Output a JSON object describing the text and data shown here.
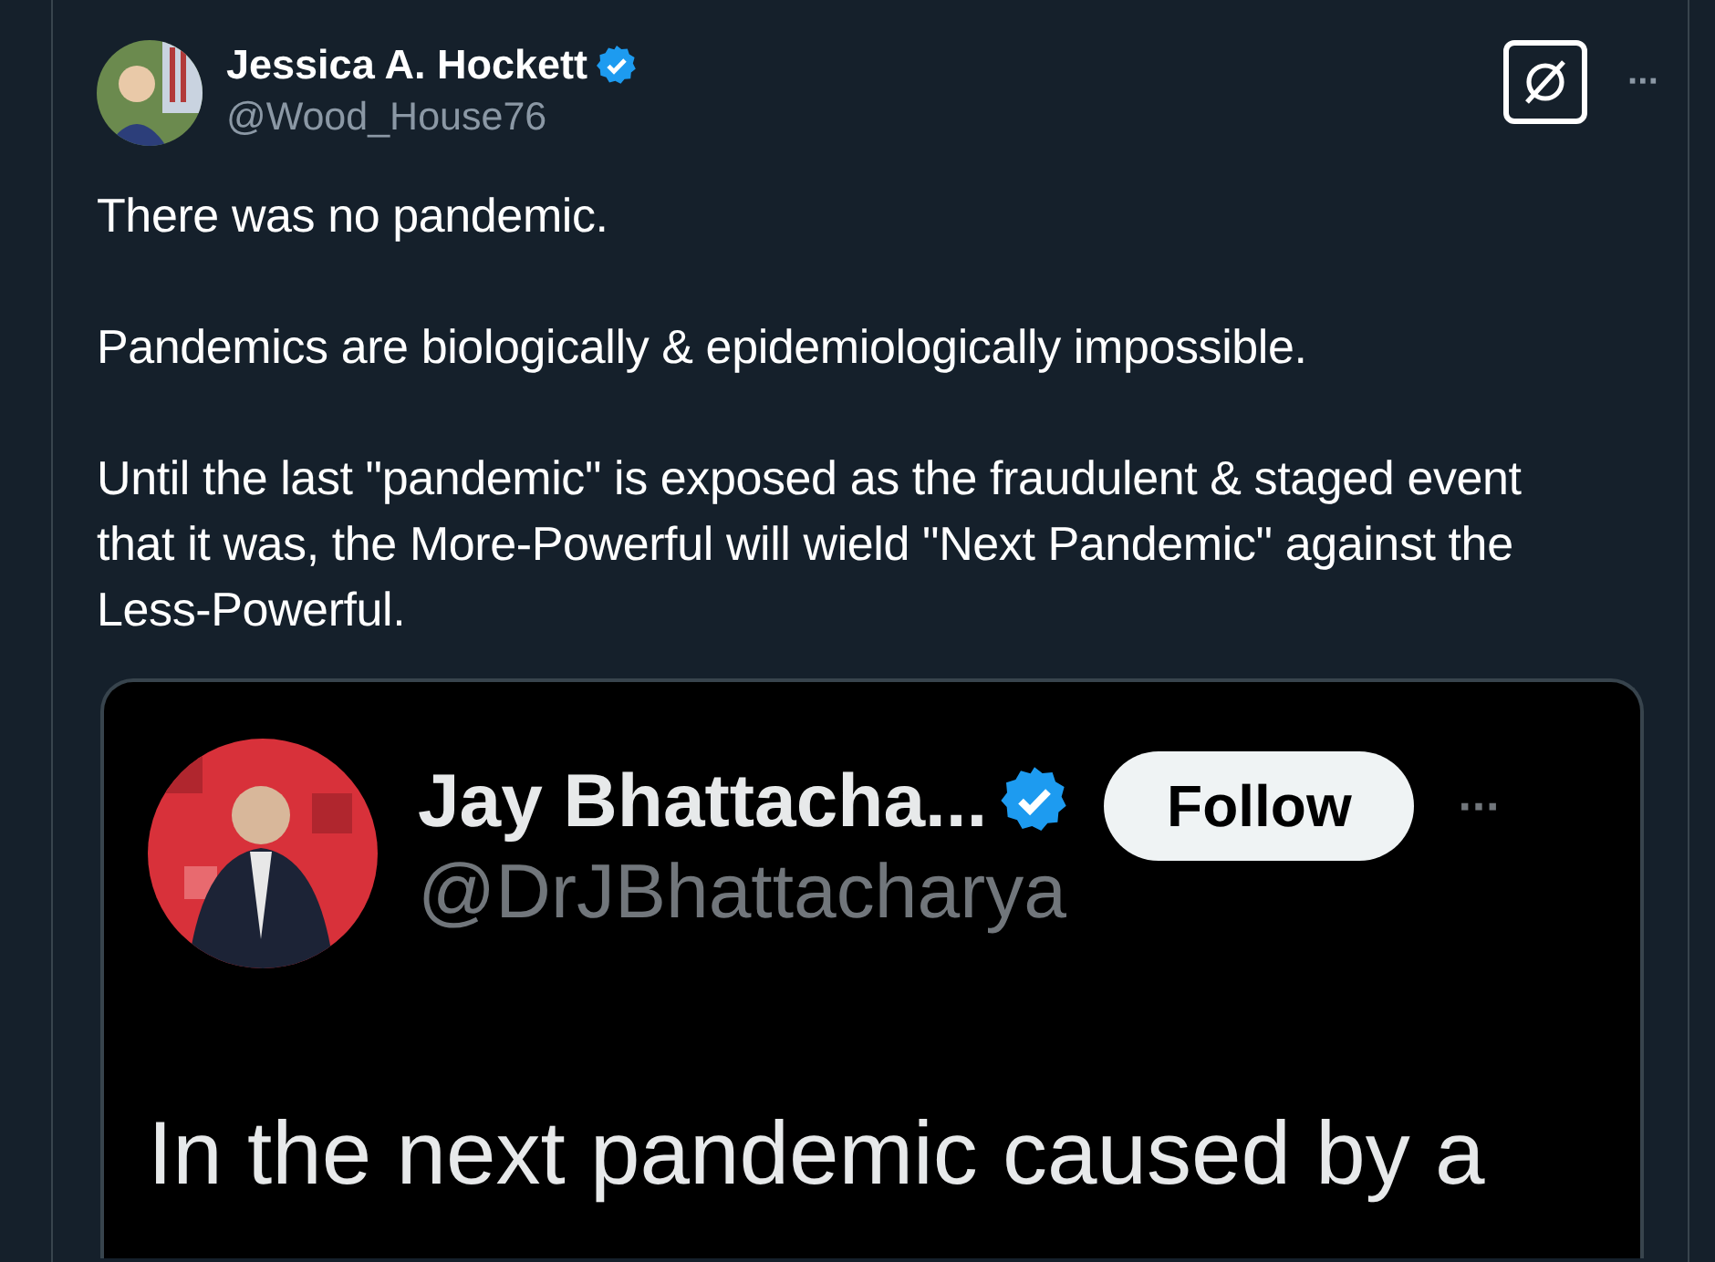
{
  "post": {
    "author": {
      "name": "Jessica A. Hockett",
      "handle": "@Wood_House76",
      "verified": true
    },
    "paragraphs": [
      "There was no pandemic.",
      "Pandemics are biologically & epidemiologically impossible.",
      "Until the last \"pandemic\" is exposed as the fraudulent & staged event that it was, the More-Powerful will wield \"Next Pandemic\" against the Less-Powerful."
    ],
    "more_label": "···"
  },
  "quoted": {
    "author": {
      "name": "Jay Bhattacha...",
      "handle": "@DrJBhattacharya",
      "verified": true
    },
    "follow_button": "Follow",
    "more_label": "···",
    "text": "In the next pandemic caused by a"
  }
}
